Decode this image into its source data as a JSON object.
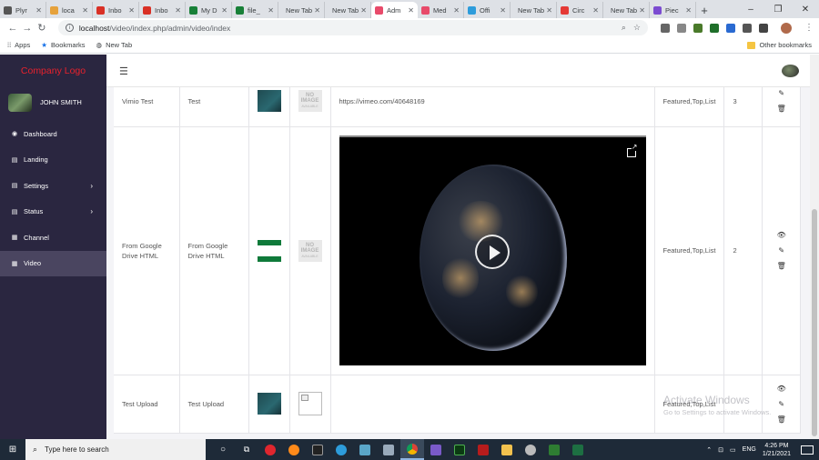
{
  "browser": {
    "tabs": [
      {
        "label": "Plyr",
        "color": "#555"
      },
      {
        "label": "loca",
        "color": "#e6a23c"
      },
      {
        "label": "Inbo",
        "color": "#d93025"
      },
      {
        "label": "Inbo",
        "color": "#d93025"
      },
      {
        "label": "My D",
        "color": "#188038"
      },
      {
        "label": "file_",
        "color": "#188038"
      },
      {
        "label": "New Tab",
        "color": ""
      },
      {
        "label": "New Tab",
        "color": ""
      },
      {
        "label": "Adm",
        "color": "#e84a6a",
        "active": true
      },
      {
        "label": "Med",
        "color": "#e84a6a"
      },
      {
        "label": "Offi",
        "color": "#2d9cdb"
      },
      {
        "label": "New Tab",
        "color": ""
      },
      {
        "label": "Circ",
        "color": "#e53935"
      },
      {
        "label": "New Tab",
        "color": ""
      },
      {
        "label": "Piec",
        "color": "#7b4bd1"
      }
    ],
    "new_tab_symbol": "+",
    "window_controls": [
      "–",
      "❐",
      "✕"
    ],
    "url_host": "localhost",
    "url_path": "/video/index.php/admin/video/index",
    "bookmarks": {
      "apps": "Apps",
      "bookmarks": "Bookmarks",
      "new_tab": "New Tab",
      "other": "Other bookmarks"
    }
  },
  "app": {
    "brand": "Company Logo",
    "user_name": "JOHN SMITH",
    "nav": [
      {
        "label": "Dashboard",
        "icon": "dashboard-icon",
        "glyph": "◉",
        "caret": ""
      },
      {
        "label": "Landing",
        "icon": "landing-icon",
        "glyph": "▤",
        "caret": ""
      },
      {
        "label": "Settings",
        "icon": "settings-icon",
        "glyph": "▤",
        "caret": "›"
      },
      {
        "label": "Status",
        "icon": "status-icon",
        "glyph": "▤",
        "caret": "›"
      },
      {
        "label": "Channel",
        "icon": "channel-icon",
        "glyph": "▦",
        "caret": ""
      },
      {
        "label": "Video",
        "icon": "video-icon",
        "glyph": "▦",
        "caret": "",
        "active": true
      }
    ],
    "hamburger": "☰"
  },
  "videos": [
    {
      "title": "Vimio Test",
      "name": "Test",
      "url": "https://vimeo.com/40648169",
      "tags": "Featured,Top,List",
      "order": "3",
      "no_image": "NO",
      "no_image2": "IMAGE",
      "no_image_small": "AVAILABLE"
    },
    {
      "title": "From Google Drive HTML",
      "name": "From Google Drive HTML",
      "tags": "Featured,Top,List",
      "order": "2",
      "no_image": "NO",
      "no_image2": "IMAGE",
      "no_image_small": "AVAILABLE"
    },
    {
      "title": "Test Upload",
      "name": "Test Upload",
      "tags": "Featured,Top,List",
      "order": ""
    }
  ],
  "action_icons": {
    "view": "👁",
    "edit": "✎",
    "delete": "🗑"
  },
  "watermark": {
    "title": "Activate Windows",
    "subtitle": "Go to Settings to activate Windows."
  },
  "taskbar": {
    "search_placeholder": "Type here to search",
    "language": "ENG",
    "time": "4:26 PM",
    "date": "1/21/2021"
  }
}
